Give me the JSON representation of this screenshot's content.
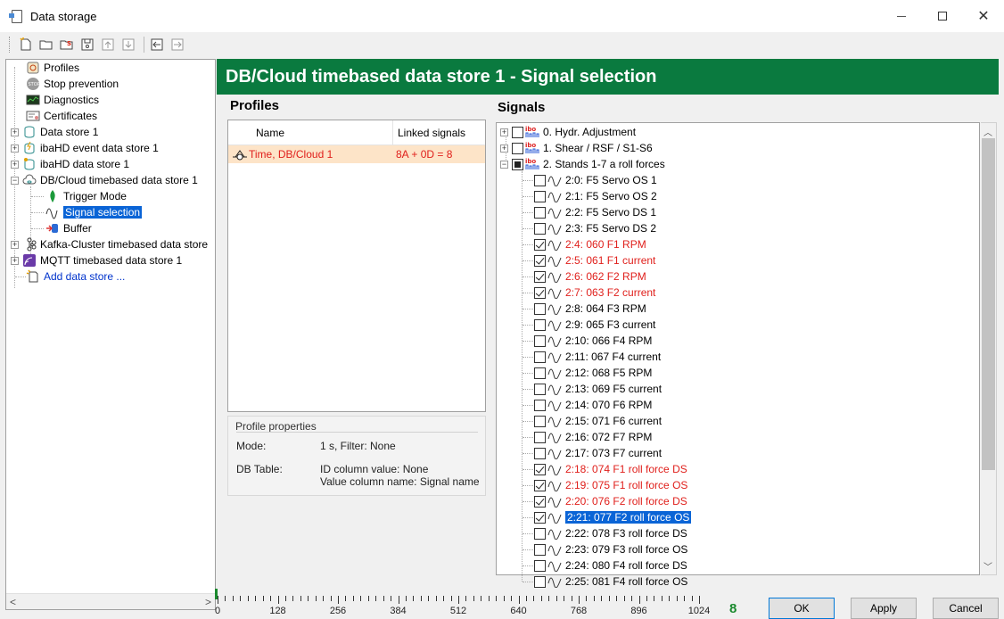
{
  "window": {
    "title": "Data storage"
  },
  "toolbar": {
    "buttons": [
      "new-icon",
      "open-folder-icon",
      "export-icon",
      "save-icon",
      "move-up-icon",
      "move-down-icon",
      "arrow-left-icon",
      "arrow-right-icon"
    ]
  },
  "tree": {
    "items": [
      {
        "label": "Profiles",
        "icon": "profiles-icon"
      },
      {
        "label": "Stop prevention",
        "icon": "stop-icon"
      },
      {
        "label": "Diagnostics",
        "icon": "diagnostics-icon"
      },
      {
        "label": "Certificates",
        "icon": "certificates-icon"
      },
      {
        "label": "Data store 1",
        "icon": "data-store-icon"
      },
      {
        "label": "ibaHD event data store 1",
        "icon": "hd-event-icon"
      },
      {
        "label": "ibaHD data store 1",
        "icon": "hd-store-icon"
      },
      {
        "label": "DB/Cloud timebased data store 1",
        "icon": "cloud-db-icon"
      },
      {
        "label": "Trigger Mode",
        "icon": "trigger-icon"
      },
      {
        "label": "Signal selection",
        "icon": "signal-wave-icon"
      },
      {
        "label": "Buffer",
        "icon": "buffer-icon"
      },
      {
        "label": "Kafka-Cluster timebased data store",
        "icon": "kafka-icon"
      },
      {
        "label": "MQTT timebased data store 1",
        "icon": "mqtt-icon"
      },
      {
        "label": "Add data store ...",
        "icon": "add-icon"
      }
    ]
  },
  "header": {
    "title": "DB/Cloud timebased data store 1 - Signal selection"
  },
  "profiles": {
    "title": "Profiles",
    "columns": [
      "Name",
      "Linked signals"
    ],
    "rows": [
      {
        "name": "Time, DB/Cloud 1",
        "linked": "8A + 0D = 8"
      }
    ],
    "properties": {
      "title": "Profile properties",
      "mode_label": "Mode:",
      "mode_value": "1 s, Filter: None",
      "table_label": "DB Table:",
      "table_value_1": "ID column value: None",
      "table_value_2": "Value column name: Signal name"
    }
  },
  "signals": {
    "title": "Signals",
    "groups": [
      {
        "label": "0. Hydr. Adjustment",
        "state": "unchecked",
        "expanded": false
      },
      {
        "label": "1. Shear / RSF / S1-S6",
        "state": "unchecked",
        "expanded": false
      },
      {
        "label": "2. Stands 1-7  a  roll forces",
        "state": "partial",
        "expanded": true
      }
    ],
    "items": [
      {
        "label": "2:0: F5 Servo OS 1",
        "checked": false
      },
      {
        "label": "2:1: F5 Servo OS 2",
        "checked": false
      },
      {
        "label": "2:2: F5 Servo  DS 1",
        "checked": false
      },
      {
        "label": "2:3: F5 Servo DS 2",
        "checked": false
      },
      {
        "label": "2:4: 060 F1 RPM",
        "checked": true
      },
      {
        "label": "2:5: 061 F1 current",
        "checked": true
      },
      {
        "label": "2:6: 062 F2 RPM",
        "checked": true
      },
      {
        "label": "2:7: 063 F2 current",
        "checked": true
      },
      {
        "label": "2:8: 064 F3 RPM",
        "checked": false
      },
      {
        "label": "2:9: 065 F3 current",
        "checked": false
      },
      {
        "label": "2:10: 066 F4 RPM",
        "checked": false
      },
      {
        "label": "2:11: 067 F4 current",
        "checked": false
      },
      {
        "label": "2:12: 068 F5 RPM",
        "checked": false
      },
      {
        "label": "2:13: 069 F5 current",
        "checked": false
      },
      {
        "label": "2:14: 070 F6 RPM",
        "checked": false
      },
      {
        "label": "2:15: 071 F6 current",
        "checked": false
      },
      {
        "label": "2:16: 072 F7 RPM",
        "checked": false
      },
      {
        "label": "2:17: 073 F7 current",
        "checked": false
      },
      {
        "label": "2:18: 074 F1 roll force DS",
        "checked": true
      },
      {
        "label": "2:19: 075 F1 roll force OS",
        "checked": true
      },
      {
        "label": "2:20: 076 F2 roll force DS",
        "checked": true
      },
      {
        "label": "2:21: 077 F2 roll force OS",
        "checked": true,
        "selected": true
      },
      {
        "label": "2:22: 078 F3 roll force DS",
        "checked": false
      },
      {
        "label": "2:23: 079 F3 roll force OS",
        "checked": false
      },
      {
        "label": "2:24: 080 F4 roll force DS",
        "checked": false
      },
      {
        "label": "2:25: 081 F4 roll force OS",
        "checked": false
      }
    ]
  },
  "ruler": {
    "labels": [
      "0",
      "128",
      "256",
      "384",
      "512",
      "640",
      "768",
      "896",
      "1024"
    ],
    "max": 1024,
    "used": 8
  },
  "footer": {
    "count": "8",
    "ok_label": "OK",
    "apply_label": "Apply",
    "cancel_label": "Cancel"
  },
  "colors": {
    "header_bg": "#0a7a3f",
    "selected_red": "#e0201c",
    "selection_blue": "#0a64d6",
    "count_green": "#1b8a2e"
  }
}
